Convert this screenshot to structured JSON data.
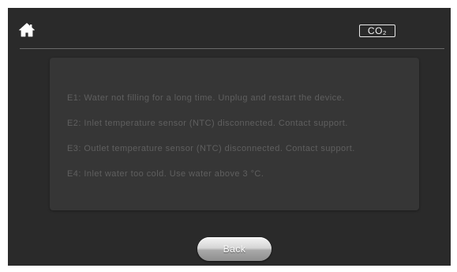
{
  "header": {
    "home_icon": "home-icon",
    "co2_label": "CO₂"
  },
  "errors": [
    {
      "text": "E1: Water not filling for a long time. Unplug and restart the device."
    },
    {
      "text": "E2: Inlet temperature sensor (NTC) disconnected. Contact support."
    },
    {
      "text": "E3: Outlet temperature sensor (NTC) disconnected. Contact support."
    },
    {
      "text": "E4: Inlet water too cold. Use water above 3 °C."
    }
  ],
  "footer": {
    "back_label": "Back"
  },
  "colors": {
    "background": "#2a2a2a",
    "panel": "#363636",
    "error_text": "#5f5f5f",
    "icon": "#ffffff"
  }
}
